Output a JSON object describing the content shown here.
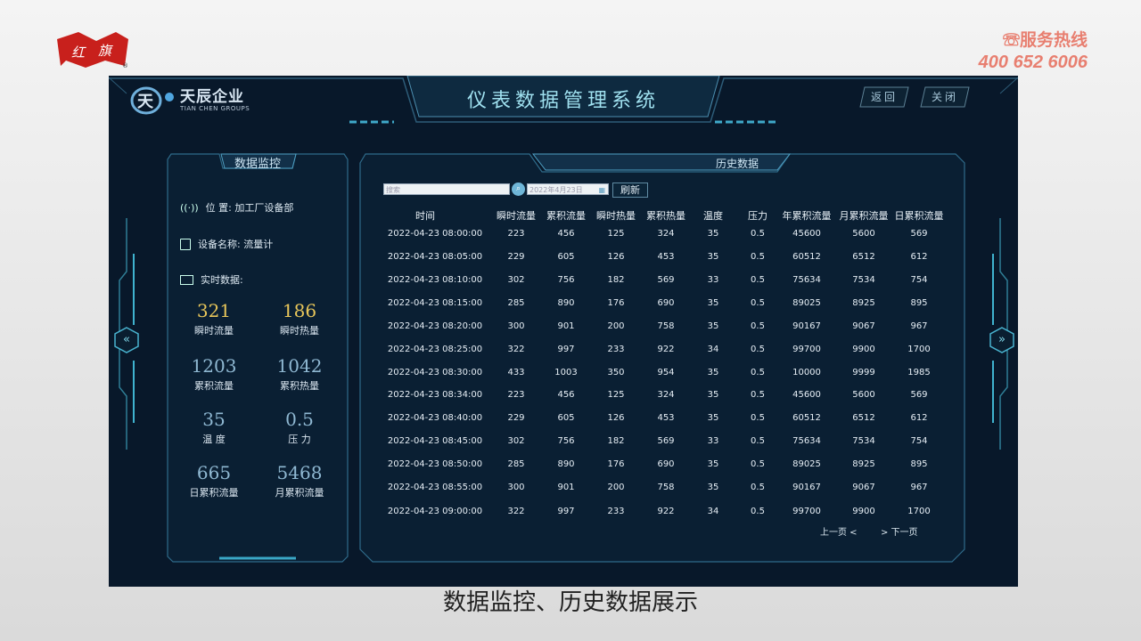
{
  "slide": {
    "hotline_label": "☏服务热线",
    "hotline_number": "400 652 6006",
    "caption": "数据监控、历史数据展示"
  },
  "app": {
    "brand_name": "天辰企业",
    "brand_sub": "TIAN CHEN GROUPS",
    "title": "仪表数据管理系统",
    "back_label": "返回",
    "close_label": "关闭"
  },
  "monitor": {
    "title": "数据监控",
    "location": "位 置: 加工厂设备部",
    "device": "设备名称: 流量计",
    "realtime": "实时数据:",
    "metrics": [
      {
        "value": "321",
        "label": "瞬时流量",
        "color": "#e8c65a"
      },
      {
        "value": "186",
        "label": "瞬时热量",
        "color": "#e8c65a"
      },
      {
        "value": "1203",
        "label": "累积流量",
        "color": "#8fb8d2"
      },
      {
        "value": "1042",
        "label": "累积热量",
        "color": "#8fb8d2"
      },
      {
        "value": "35",
        "label": "温 度",
        "color": "#8fb8d2"
      },
      {
        "value": "0.5",
        "label": "压 力",
        "color": "#8fb8d2"
      },
      {
        "value": "665",
        "label": "日累积流量",
        "color": "#8fb8d2"
      },
      {
        "value": "5468",
        "label": "月累积流量",
        "color": "#8fb8d2"
      }
    ]
  },
  "history": {
    "title": "历史数据",
    "search_placeholder": "搜索",
    "date_value": "2022年4月23日",
    "refresh_label": "刷新",
    "prev_label": "上一页 <",
    "next_label": "> 下一页",
    "columns": [
      "时间",
      "瞬时流量",
      "累积流量",
      "瞬时热量",
      "累积热量",
      "温度",
      "压力",
      "年累积流量",
      "月累积流量",
      "日累积流量"
    ],
    "rows": [
      [
        "2022-04-23  08:00:00",
        "223",
        "456",
        "125",
        "324",
        "35",
        "0.5",
        "45600",
        "5600",
        "569"
      ],
      [
        "2022-04-23  08:05:00",
        "229",
        "605",
        "126",
        "453",
        "35",
        "0.5",
        "60512",
        "6512",
        "612"
      ],
      [
        "2022-04-23  08:10:00",
        "302",
        "756",
        "182",
        "569",
        "33",
        "0.5",
        "75634",
        "7534",
        "754"
      ],
      [
        "2022-04-23  08:15:00",
        "285",
        "890",
        "176",
        "690",
        "35",
        "0.5",
        "89025",
        "8925",
        "895"
      ],
      [
        "2022-04-23  08:20:00",
        "300",
        "901",
        "200",
        "758",
        "35",
        "0.5",
        "90167",
        "9067",
        "967"
      ],
      [
        "2022-04-23  08:25:00",
        "322",
        "997",
        "233",
        "922",
        "34",
        "0.5",
        "99700",
        "9900",
        "1700"
      ],
      [
        "2022-04-23  08:30:00",
        "433",
        "1003",
        "350",
        "954",
        "35",
        "0.5",
        "10000",
        "9999",
        "1985"
      ],
      [
        "2022-04-23  08:34:00",
        "223",
        "456",
        "125",
        "324",
        "35",
        "0.5",
        "45600",
        "5600",
        "569"
      ],
      [
        "2022-04-23  08:40:00",
        "229",
        "605",
        "126",
        "453",
        "35",
        "0.5",
        "60512",
        "6512",
        "612"
      ],
      [
        "2022-04-23  08:45:00",
        "302",
        "756",
        "182",
        "569",
        "33",
        "0.5",
        "75634",
        "7534",
        "754"
      ],
      [
        "2022-04-23  08:50:00",
        "285",
        "890",
        "176",
        "690",
        "35",
        "0.5",
        "89025",
        "8925",
        "895"
      ],
      [
        "2022-04-23  08:55:00",
        "300",
        "901",
        "200",
        "758",
        "35",
        "0.5",
        "90167",
        "9067",
        "967"
      ],
      [
        "2022-04-23  09:00:00",
        "322",
        "997",
        "233",
        "922",
        "34",
        "0.5",
        "99700",
        "9900",
        "1700"
      ]
    ]
  },
  "nav": {
    "left_arrow": "«",
    "right_arrow": "»"
  }
}
